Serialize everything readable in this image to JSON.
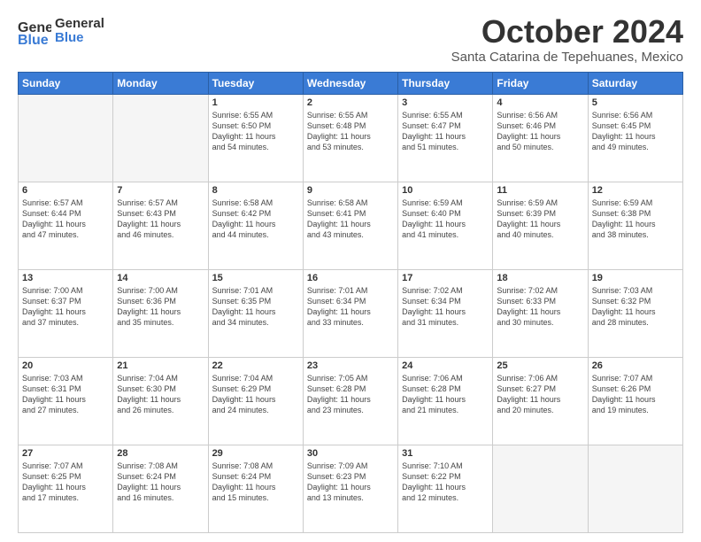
{
  "header": {
    "logo_line1": "General",
    "logo_line2": "Blue",
    "month": "October 2024",
    "location": "Santa Catarina de Tepehuanes, Mexico"
  },
  "weekdays": [
    "Sunday",
    "Monday",
    "Tuesday",
    "Wednesday",
    "Thursday",
    "Friday",
    "Saturday"
  ],
  "weeks": [
    [
      {
        "day": "",
        "info": ""
      },
      {
        "day": "",
        "info": ""
      },
      {
        "day": "1",
        "info": "Sunrise: 6:55 AM\nSunset: 6:50 PM\nDaylight: 11 hours\nand 54 minutes."
      },
      {
        "day": "2",
        "info": "Sunrise: 6:55 AM\nSunset: 6:48 PM\nDaylight: 11 hours\nand 53 minutes."
      },
      {
        "day": "3",
        "info": "Sunrise: 6:55 AM\nSunset: 6:47 PM\nDaylight: 11 hours\nand 51 minutes."
      },
      {
        "day": "4",
        "info": "Sunrise: 6:56 AM\nSunset: 6:46 PM\nDaylight: 11 hours\nand 50 minutes."
      },
      {
        "day": "5",
        "info": "Sunrise: 6:56 AM\nSunset: 6:45 PM\nDaylight: 11 hours\nand 49 minutes."
      }
    ],
    [
      {
        "day": "6",
        "info": "Sunrise: 6:57 AM\nSunset: 6:44 PM\nDaylight: 11 hours\nand 47 minutes."
      },
      {
        "day": "7",
        "info": "Sunrise: 6:57 AM\nSunset: 6:43 PM\nDaylight: 11 hours\nand 46 minutes."
      },
      {
        "day": "8",
        "info": "Sunrise: 6:58 AM\nSunset: 6:42 PM\nDaylight: 11 hours\nand 44 minutes."
      },
      {
        "day": "9",
        "info": "Sunrise: 6:58 AM\nSunset: 6:41 PM\nDaylight: 11 hours\nand 43 minutes."
      },
      {
        "day": "10",
        "info": "Sunrise: 6:59 AM\nSunset: 6:40 PM\nDaylight: 11 hours\nand 41 minutes."
      },
      {
        "day": "11",
        "info": "Sunrise: 6:59 AM\nSunset: 6:39 PM\nDaylight: 11 hours\nand 40 minutes."
      },
      {
        "day": "12",
        "info": "Sunrise: 6:59 AM\nSunset: 6:38 PM\nDaylight: 11 hours\nand 38 minutes."
      }
    ],
    [
      {
        "day": "13",
        "info": "Sunrise: 7:00 AM\nSunset: 6:37 PM\nDaylight: 11 hours\nand 37 minutes."
      },
      {
        "day": "14",
        "info": "Sunrise: 7:00 AM\nSunset: 6:36 PM\nDaylight: 11 hours\nand 35 minutes."
      },
      {
        "day": "15",
        "info": "Sunrise: 7:01 AM\nSunset: 6:35 PM\nDaylight: 11 hours\nand 34 minutes."
      },
      {
        "day": "16",
        "info": "Sunrise: 7:01 AM\nSunset: 6:34 PM\nDaylight: 11 hours\nand 33 minutes."
      },
      {
        "day": "17",
        "info": "Sunrise: 7:02 AM\nSunset: 6:34 PM\nDaylight: 11 hours\nand 31 minutes."
      },
      {
        "day": "18",
        "info": "Sunrise: 7:02 AM\nSunset: 6:33 PM\nDaylight: 11 hours\nand 30 minutes."
      },
      {
        "day": "19",
        "info": "Sunrise: 7:03 AM\nSunset: 6:32 PM\nDaylight: 11 hours\nand 28 minutes."
      }
    ],
    [
      {
        "day": "20",
        "info": "Sunrise: 7:03 AM\nSunset: 6:31 PM\nDaylight: 11 hours\nand 27 minutes."
      },
      {
        "day": "21",
        "info": "Sunrise: 7:04 AM\nSunset: 6:30 PM\nDaylight: 11 hours\nand 26 minutes."
      },
      {
        "day": "22",
        "info": "Sunrise: 7:04 AM\nSunset: 6:29 PM\nDaylight: 11 hours\nand 24 minutes."
      },
      {
        "day": "23",
        "info": "Sunrise: 7:05 AM\nSunset: 6:28 PM\nDaylight: 11 hours\nand 23 minutes."
      },
      {
        "day": "24",
        "info": "Sunrise: 7:06 AM\nSunset: 6:28 PM\nDaylight: 11 hours\nand 21 minutes."
      },
      {
        "day": "25",
        "info": "Sunrise: 7:06 AM\nSunset: 6:27 PM\nDaylight: 11 hours\nand 20 minutes."
      },
      {
        "day": "26",
        "info": "Sunrise: 7:07 AM\nSunset: 6:26 PM\nDaylight: 11 hours\nand 19 minutes."
      }
    ],
    [
      {
        "day": "27",
        "info": "Sunrise: 7:07 AM\nSunset: 6:25 PM\nDaylight: 11 hours\nand 17 minutes."
      },
      {
        "day": "28",
        "info": "Sunrise: 7:08 AM\nSunset: 6:24 PM\nDaylight: 11 hours\nand 16 minutes."
      },
      {
        "day": "29",
        "info": "Sunrise: 7:08 AM\nSunset: 6:24 PM\nDaylight: 11 hours\nand 15 minutes."
      },
      {
        "day": "30",
        "info": "Sunrise: 7:09 AM\nSunset: 6:23 PM\nDaylight: 11 hours\nand 13 minutes."
      },
      {
        "day": "31",
        "info": "Sunrise: 7:10 AM\nSunset: 6:22 PM\nDaylight: 11 hours\nand 12 minutes."
      },
      {
        "day": "",
        "info": ""
      },
      {
        "day": "",
        "info": ""
      }
    ]
  ]
}
